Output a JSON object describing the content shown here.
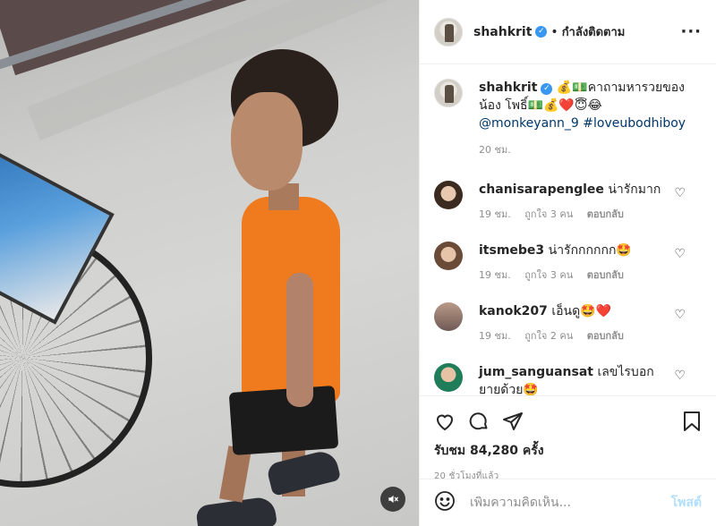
{
  "post": {
    "username": "shahkrit",
    "verified_icon": "verified-badge-icon",
    "dot": "•",
    "follow_status": "กำลังติดตาม",
    "more_icon": "more-options-icon",
    "mute_icon": "muted-speaker-icon"
  },
  "caption": {
    "username": "shahkrit",
    "text_part1": "💰💵คาถามหารวยของน้อง โพธิ์💵💰❤️😇😂",
    "mention": "@monkeyann_9",
    "hashtag": "#loveubodhiboy",
    "time": "20 ชม."
  },
  "comments": [
    {
      "username": "chanisarapenglee",
      "text": "น่ารักมาก",
      "time": "19 ชม.",
      "likes": "ถูกใจ 3 คน",
      "reply": "ตอบกลับ"
    },
    {
      "username": "itsmebe3",
      "text": "น่ารักกกกกก🤩",
      "time": "19 ชม.",
      "likes": "ถูกใจ 3 คน",
      "reply": "ตอบกลับ"
    },
    {
      "username": "kanok207",
      "text": "เอ็นดู🤩❤️",
      "time": "19 ชม.",
      "likes": "ถูกใจ 2 คน",
      "reply": "ตอบกลับ"
    },
    {
      "username": "jum_sanguansat",
      "text": "เลขไรบอกยายด้วย🤩",
      "time": "",
      "likes": "",
      "reply": ""
    }
  ],
  "actions": {
    "views_label": "รับชม 84,280 ครั้ง",
    "posted": "20 ชั่วโมงที่แล้ว"
  },
  "add_comment": {
    "placeholder": "เพิ่มความคิดเห็น...",
    "post_label": "โพสต์",
    "emoji_icon": "emoji-icon"
  },
  "colors": {
    "link": "#00376b",
    "meta": "#8e8e8e",
    "verified": "#3897f0",
    "post_disabled": "#b2dffc"
  }
}
